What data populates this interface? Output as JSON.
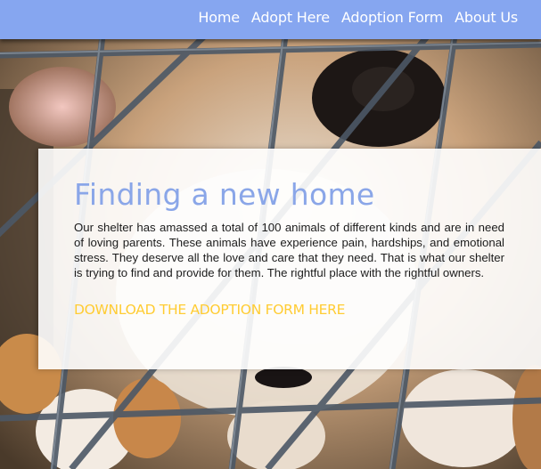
{
  "nav": {
    "items": [
      "Home",
      "Adopt Here",
      "Adoption Form",
      "About Us"
    ],
    "background": "#86a6f0",
    "text_color": "#ffffff"
  },
  "hero": {
    "image": "puppy-behind-cage-photo"
  },
  "card": {
    "title": "Finding a new home",
    "body": "Our shelter has amassed a total of 100 animals of different kinds and are in need of loving parents. These animals have experience pain, hardships, and emotional stress. They deserve all the love and care that they need. That is what our shelter is trying to find and provide for them. The rightful place with the rightful owners.",
    "cta": "DOWNLOAD THE ADOPTION FORM HERE",
    "title_color": "#8aa6e8",
    "cta_color": "#ffcc33"
  }
}
